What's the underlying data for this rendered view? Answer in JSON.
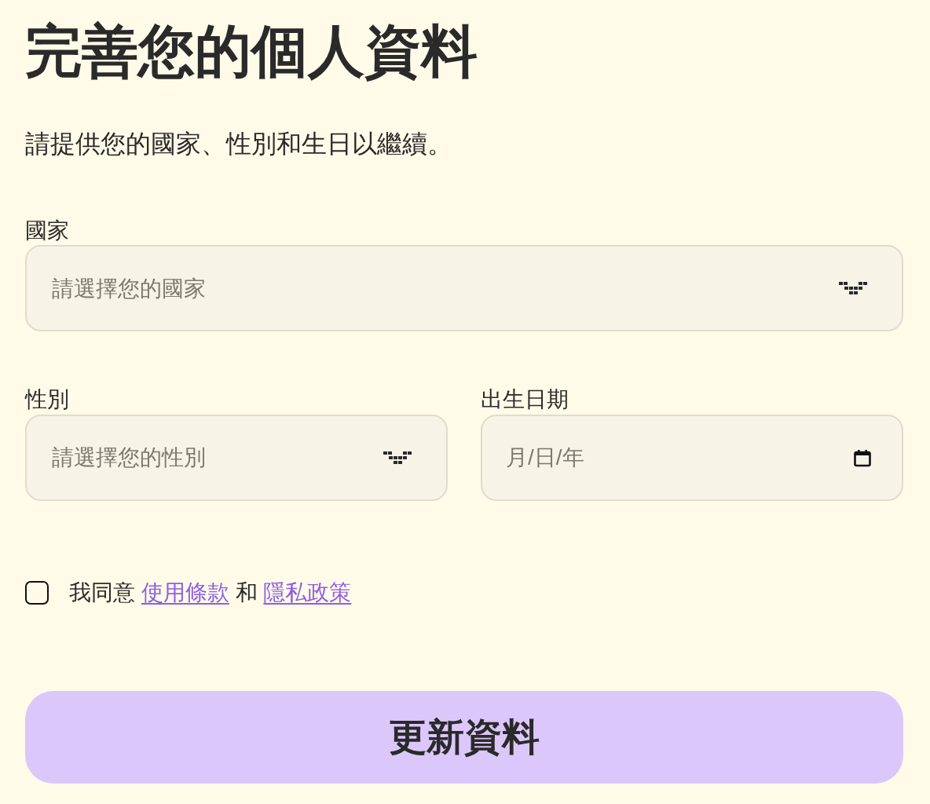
{
  "title": "完善您的個人資料",
  "subtitle": "請提供您的國家、性別和生日以繼續。",
  "field_rows": [
    {
      "fields": [
        {
          "kind": "select",
          "label": "國家",
          "placeholder": "請選擇您的國家"
        }
      ]
    },
    {
      "fields": [
        {
          "kind": "select",
          "label": "性別",
          "placeholder": "請選擇您的性別"
        },
        {
          "kind": "date",
          "label": "出生日期",
          "placeholder": "月/日/年"
        }
      ]
    }
  ],
  "agreement": {
    "checked": false,
    "parts": [
      {
        "kind": "text",
        "text": "我同意"
      },
      {
        "kind": "link",
        "text": "使用條款"
      },
      {
        "kind": "text",
        "text": "和"
      },
      {
        "kind": "link",
        "text": "隱私政策"
      }
    ]
  },
  "submit_button": {
    "label": "更新資料"
  }
}
